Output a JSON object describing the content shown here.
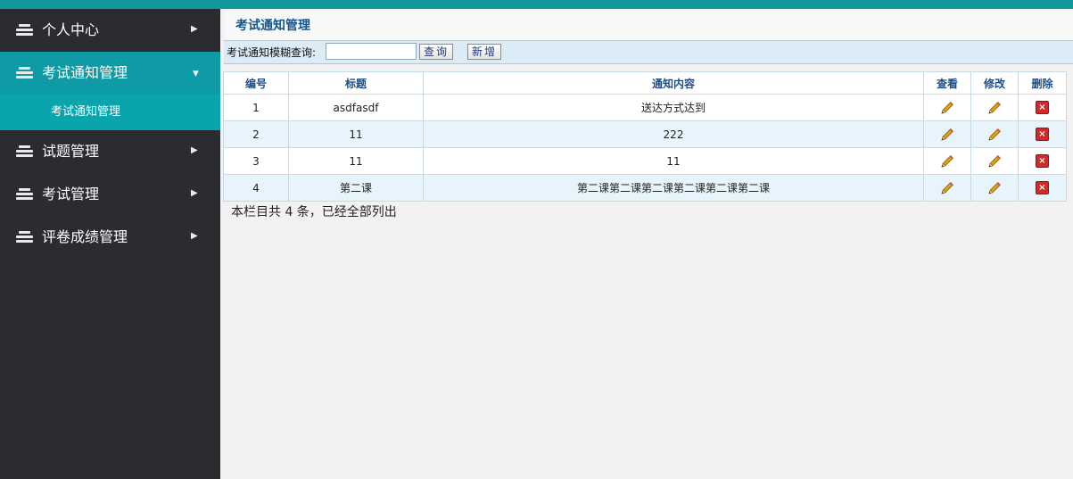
{
  "sidebar": {
    "items": [
      {
        "label": "个人中心"
      },
      {
        "label": "考试通知管理",
        "sub": "考试通知管理"
      },
      {
        "label": "试题管理"
      },
      {
        "label": "考试管理"
      },
      {
        "label": "评卷成绩管理"
      }
    ]
  },
  "main": {
    "title": "考试通知管理",
    "search": {
      "label": "考试通知模糊查询:",
      "value": "",
      "placeholder": "",
      "search_button": "查询",
      "add_button": "新增"
    },
    "table": {
      "headers": [
        "编号",
        "标题",
        "通知内容",
        "查看",
        "修改",
        "删除"
      ],
      "rows": [
        {
          "id": "1",
          "title": "asdfasdf",
          "content": "送达方式达到"
        },
        {
          "id": "2",
          "title": "11",
          "content": "222"
        },
        {
          "id": "3",
          "title": "11",
          "content": "11"
        },
        {
          "id": "4",
          "title": "第二课",
          "content": "第二课第二课第二课第二课第二课第二课"
        }
      ]
    },
    "summary": "本栏目共 4 条，已经全部列出"
  },
  "icons": {
    "menu": "stack-icon",
    "collapsed": "caret-right-icon",
    "expanded": "caret-down-icon",
    "view": "pencil-icon",
    "edit": "pencil-icon",
    "delete": "delete-icon"
  },
  "colors": {
    "accent": "#12979c",
    "sidebar_bg": "#2b2c30",
    "active_bg": "#0e9ba5",
    "title_text": "#14578f"
  }
}
